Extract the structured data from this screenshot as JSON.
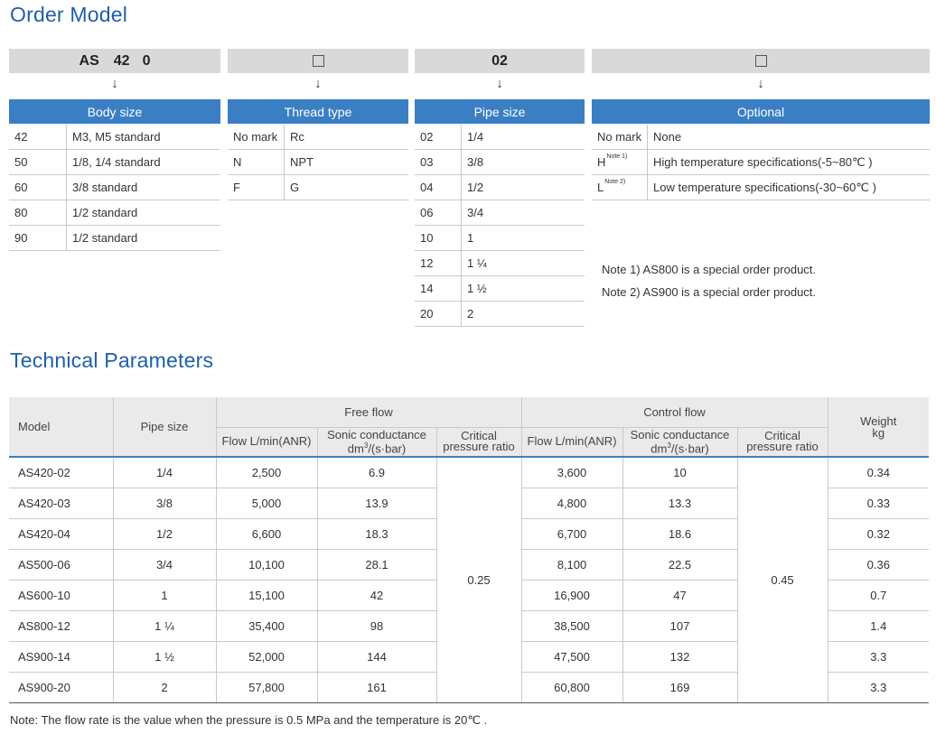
{
  "sections": {
    "order_title": "Order Model",
    "tech_title": "Technical Parameters"
  },
  "order": {
    "code": {
      "a": "AS",
      "b": "42",
      "c": "0",
      "pipe": "02"
    },
    "arrow": "↓",
    "body_size": {
      "header": "Body size",
      "rows": [
        {
          "code": "42",
          "desc": "M3, M5 standard"
        },
        {
          "code": "50",
          "desc": "1/8, 1/4 standard"
        },
        {
          "code": "60",
          "desc": "3/8 standard"
        },
        {
          "code": "80",
          "desc": "1/2 standard"
        },
        {
          "code": "90",
          "desc": "1/2 standard"
        }
      ]
    },
    "thread_type": {
      "header": "Thread type",
      "rows": [
        {
          "code": "No mark",
          "desc": "Rc"
        },
        {
          "code": "N",
          "desc": "NPT"
        },
        {
          "code": "F",
          "desc": "G"
        }
      ]
    },
    "pipe_size": {
      "header": "Pipe size",
      "rows": [
        {
          "code": "02",
          "desc": "1/4"
        },
        {
          "code": "03",
          "desc": "3/8"
        },
        {
          "code": "04",
          "desc": "1/2"
        },
        {
          "code": "06",
          "desc": "3/4"
        },
        {
          "code": "10",
          "desc": "1"
        },
        {
          "code": "12",
          "desc": "1 ¼"
        },
        {
          "code": "14",
          "desc": "1 ½"
        },
        {
          "code": "20",
          "desc": "2"
        }
      ]
    },
    "optional": {
      "header": "Optional",
      "rows": [
        {
          "code": "No mark",
          "sup": "",
          "desc": "None"
        },
        {
          "code": "H",
          "sup": "Note 1)",
          "desc": "High temperature specifications(-5~80℃ )"
        },
        {
          "code": "L",
          "sup": "Note 2)",
          "desc": "Low temperature specifications(-30~60℃ )"
        }
      ]
    },
    "notes": [
      "Note 1)  AS800 is a special order product.",
      "Note 2)  AS900 is a special order product."
    ]
  },
  "tech": {
    "headers": {
      "model": "Model",
      "pipe_size": "Pipe size",
      "free_flow": "Free flow",
      "control_flow": "Control flow",
      "weight": "Weight",
      "weight_unit": "kg",
      "flow": "Flow L/min(ANR)",
      "sonic": "Sonic conductance",
      "sonic_unit_a": "dm",
      "sonic_unit_sup": "3",
      "sonic_unit_b": "/(s·bar)",
      "critical": "Critical",
      "pressure_ratio": "pressure ratio"
    },
    "free_critical": "0.25",
    "control_critical": "0.45",
    "rows": [
      {
        "model": "AS420-02",
        "pipe": "1/4",
        "free_flow": "2,500",
        "free_sonic": "6.9",
        "ctrl_flow": "3,600",
        "ctrl_sonic": "10",
        "weight": "0.34"
      },
      {
        "model": "AS420-03",
        "pipe": "3/8",
        "free_flow": "5,000",
        "free_sonic": "13.9",
        "ctrl_flow": "4,800",
        "ctrl_sonic": "13.3",
        "weight": "0.33"
      },
      {
        "model": "AS420-04",
        "pipe": "1/2",
        "free_flow": "6,600",
        "free_sonic": "18.3",
        "ctrl_flow": "6,700",
        "ctrl_sonic": "18.6",
        "weight": "0.32"
      },
      {
        "model": "AS500-06",
        "pipe": "3/4",
        "free_flow": "10,100",
        "free_sonic": "28.1",
        "ctrl_flow": "8,100",
        "ctrl_sonic": "22.5",
        "weight": "0.36"
      },
      {
        "model": "AS600-10",
        "pipe": "1",
        "free_flow": "15,100",
        "free_sonic": "42",
        "ctrl_flow": "16,900",
        "ctrl_sonic": "47",
        "weight": "0.7"
      },
      {
        "model": "AS800-12",
        "pipe": "1 ¼",
        "free_flow": "35,400",
        "free_sonic": "98",
        "ctrl_flow": "38,500",
        "ctrl_sonic": "107",
        "weight": "1.4"
      },
      {
        "model": "AS900-14",
        "pipe": "1 ½",
        "free_flow": "52,000",
        "free_sonic": "144",
        "ctrl_flow": "47,500",
        "ctrl_sonic": "132",
        "weight": "3.3"
      },
      {
        "model": "AS900-20",
        "pipe": "2",
        "free_flow": "57,800",
        "free_sonic": "161",
        "ctrl_flow": "60,800",
        "ctrl_sonic": "169",
        "weight": "3.3"
      }
    ],
    "footnote": "Note: The flow rate is the value when the pressure is 0.5 MPa and the temperature is 20℃ ."
  }
}
